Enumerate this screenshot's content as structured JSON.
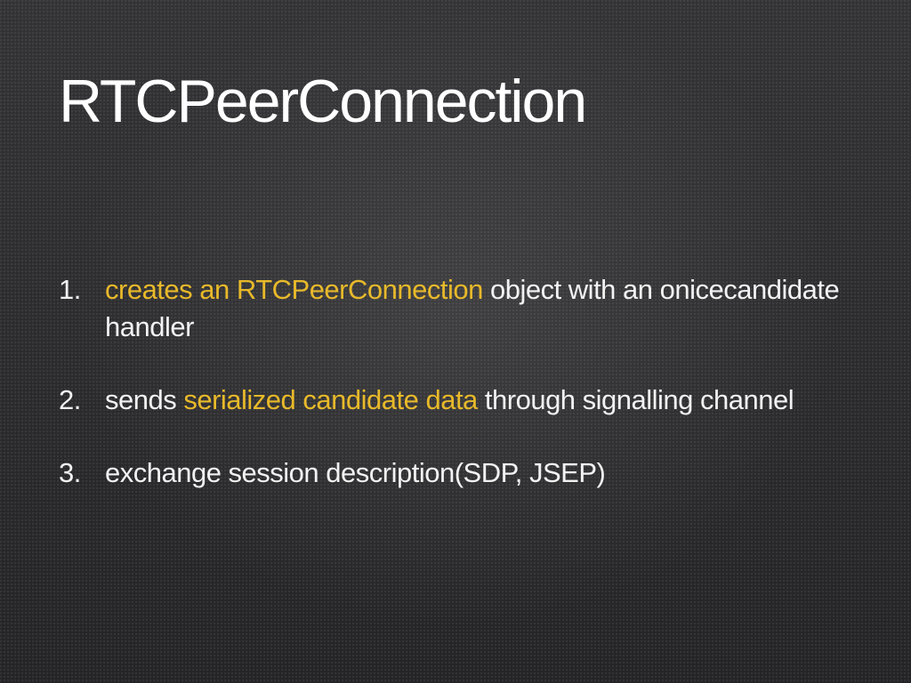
{
  "slide": {
    "title": "RTCPeerConnection",
    "items": [
      {
        "number": "1.",
        "segments": [
          {
            "text": "creates an RTCPeerConnection",
            "highlight": true
          },
          {
            "text": " object with an onicecandidate handler",
            "highlight": false
          }
        ]
      },
      {
        "number": "2.",
        "segments": [
          {
            "text": "sends ",
            "highlight": false
          },
          {
            "text": "serialized candidate data",
            "highlight": true
          },
          {
            "text": " through signalling channel",
            "highlight": false
          }
        ]
      },
      {
        "number": "3.",
        "segments": [
          {
            "text": "exchange session description(SDP, JSEP)",
            "highlight": false
          }
        ]
      }
    ]
  },
  "colors": {
    "background": "#2f2f31",
    "text": "#f2f2f2",
    "highlight": "#e8b92a"
  }
}
